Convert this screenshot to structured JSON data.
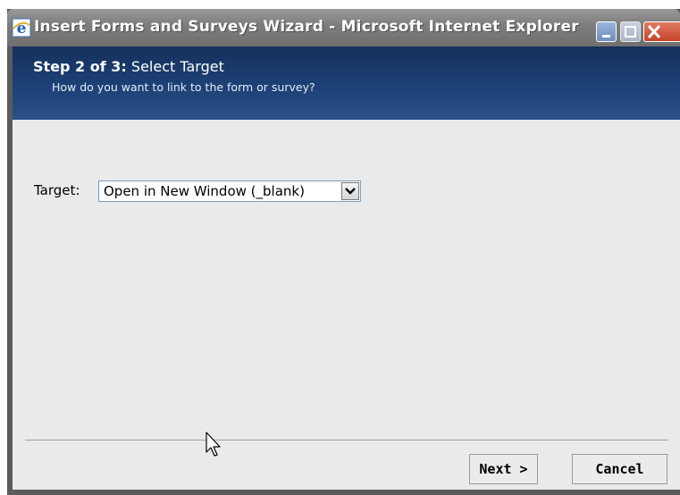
{
  "window": {
    "title": "Insert Forms and Surveys Wizard - Microsoft Internet Explorer",
    "icon": "ie-icon",
    "controls": [
      "minimize-icon",
      "maximize-icon",
      "close-icon"
    ]
  },
  "header": {
    "step_prefix": "Step 2 of 3:",
    "step_title": "Select Target",
    "subtitle": "How do you want to link to the form or survey?"
  },
  "form": {
    "target_label": "Target:",
    "target_value": "Open in New Window (_blank)"
  },
  "footer": {
    "next_label": "Next >",
    "cancel_label": "Cancel"
  },
  "colors": {
    "header_band": "#1d4176",
    "titlebar": "#7e7e7e",
    "client_bg": "#eaeaea"
  }
}
